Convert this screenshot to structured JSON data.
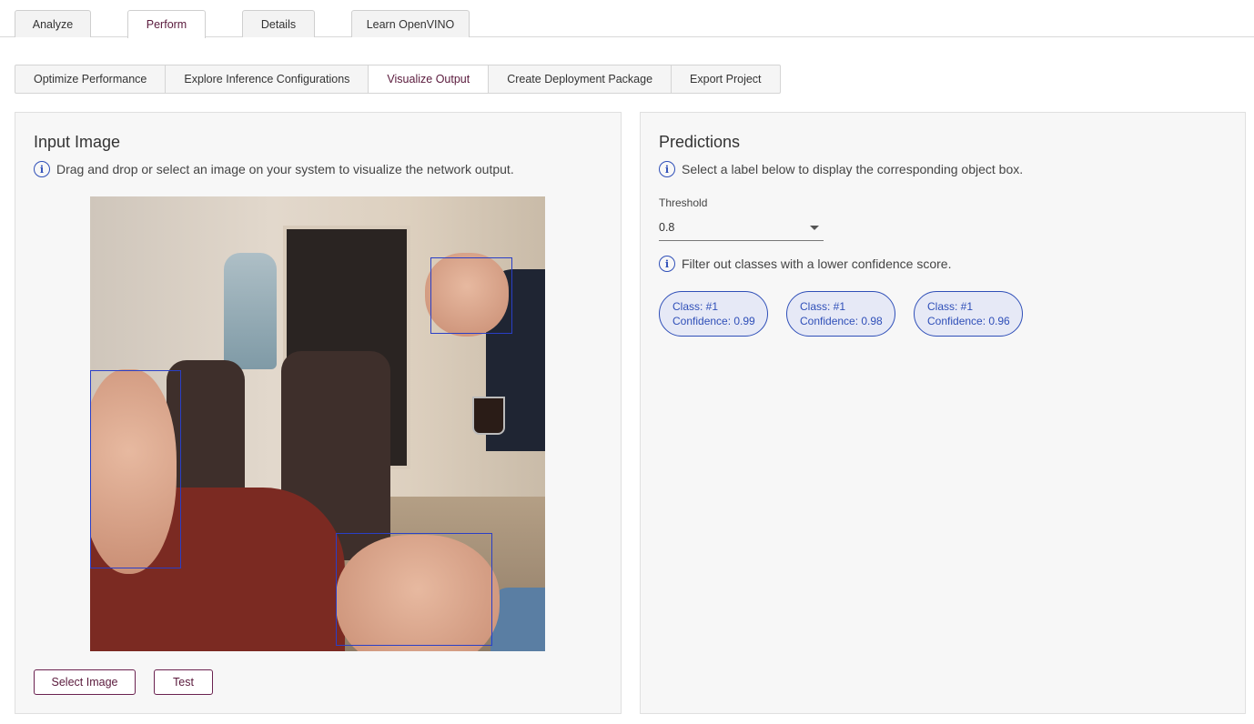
{
  "top_tabs": [
    {
      "label": "Analyze"
    },
    {
      "label": "Perform"
    },
    {
      "label": "Details"
    },
    {
      "label": "Learn OpenVINO"
    }
  ],
  "active_top_tab": "Perform",
  "sub_tabs": [
    {
      "label": "Optimize Performance"
    },
    {
      "label": "Explore Inference Configurations"
    },
    {
      "label": "Visualize Output"
    },
    {
      "label": "Create Deployment Package"
    },
    {
      "label": "Export Project"
    }
  ],
  "active_sub_tab": "Visualize Output",
  "input_panel": {
    "title": "Input Image",
    "hint": "Drag and drop or select an image on your system to visualize the network output.",
    "select_button": "Select Image",
    "test_button": "Test"
  },
  "predictions_panel": {
    "title": "Predictions",
    "hint": "Select a label below to display the corresponding object box.",
    "threshold_label": "Threshold",
    "threshold_value": "0.8",
    "filter_hint": "Filter out classes with a lower confidence score.",
    "predictions": [
      {
        "class": "Class: #1",
        "confidence": "Confidence: 0.99"
      },
      {
        "class": "Class: #1",
        "confidence": "Confidence: 0.98"
      },
      {
        "class": "Class: #1",
        "confidence": "Confidence: 0.96"
      }
    ]
  },
  "colors": {
    "accent": "#5a1a3c",
    "box": "#2a3fc6",
    "chip": "#2f4fb8"
  }
}
